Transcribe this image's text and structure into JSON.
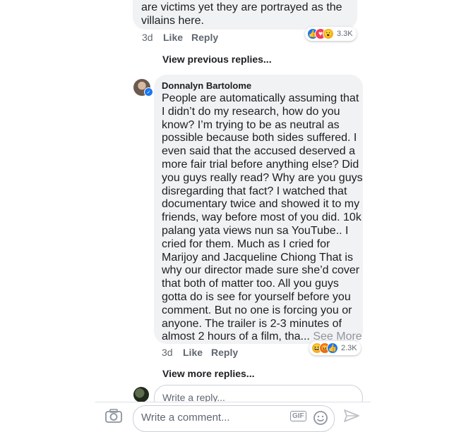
{
  "prev_comment": {
    "text_line1": "are victims yet they are portrayed as the",
    "text_line2": "villains here.",
    "time": "3d",
    "like_label": "Like",
    "reply_label": "Reply",
    "reaction_count": "3.3K",
    "reactions": [
      "like",
      "love",
      "wow"
    ]
  },
  "view_previous_replies": "View previous replies...",
  "reply": {
    "author": "Donnalyn Bartolome",
    "text": "People are automatically assuming that\nI didn’t do my research, how do you\nknow? I’m trying to be as neutral as\npossible because both sides suffered. I\neven said that the accused deserved a\nmore fair trial before anything else? Did\nyou guys really read? Why are you guys\ndisregarding that fact? I watched that\ndocumentary twice and showed it to my\nfriends, way before most of you did. 10k\npalang yata views nun sa YouTube.. I\ncried for them. Much as I cried for\nMarijoy and Jacqueline Chiong That is\nwhy our director made sure she’d cover\nthat both of matter too. All you guys\ngotta do is see for yourself before you\ncomment. But no one is forcing you or\nanyone. The trailer is 2-3 minutes of",
    "last_line": "almost 2 hours of a film, tha...",
    "see_more": "See More",
    "time": "3d",
    "like_label": "Like",
    "reply_label": "Reply",
    "reaction_count": "2.3K",
    "reactions": [
      "haha",
      "angry",
      "like"
    ]
  },
  "view_more_replies": "View more replies...",
  "reply_box": {
    "placeholder": "Write a reply..."
  },
  "comment_bar": {
    "placeholder": "Write a comment...",
    "gif_label": "GIF"
  },
  "colors": {
    "like": "#1877f2",
    "love": "#f33e58",
    "wow": "#f7b125",
    "angry": "#e9710f",
    "bubble": "#f1f2f4"
  }
}
